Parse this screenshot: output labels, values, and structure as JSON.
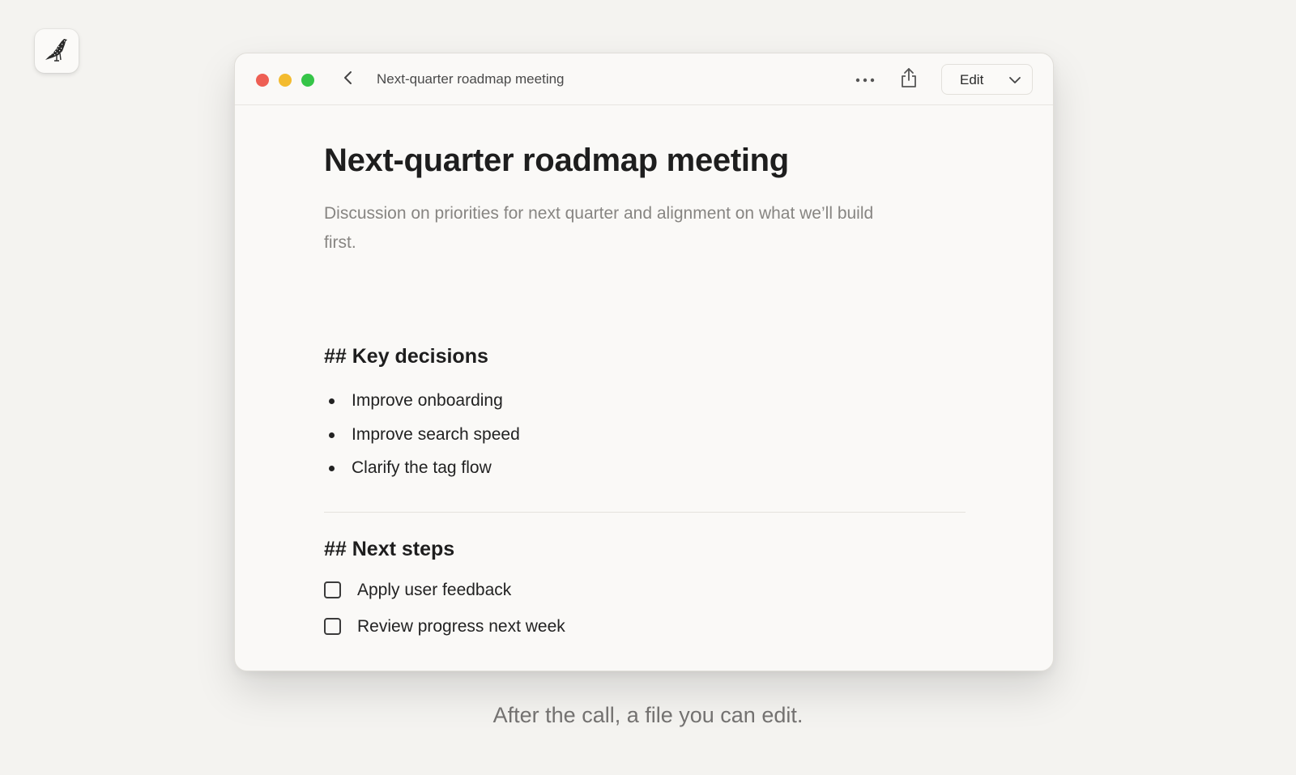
{
  "app": {
    "logo_icon": "bird-icon"
  },
  "window": {
    "title": "Next-quarter roadmap meeting",
    "controls": {
      "close_color": "#ee5f54",
      "minimize_color": "#f3bb2f",
      "maximize_color": "#35c548"
    },
    "toolbar": {
      "back_icon": "chevron-left-icon",
      "more_icon": "ellipsis-icon",
      "share_icon": "share-icon",
      "edit_label": "Edit",
      "edit_dropdown_icon": "chevron-down-icon"
    }
  },
  "document": {
    "title": "Next-quarter roadmap meeting",
    "subtitle": "Discussion on priorities for next quarter and alignment on what we’ll build first.",
    "sections": [
      {
        "heading": "## Key decisions",
        "items": [
          "Improve onboarding",
          "Improve search speed",
          "Clarify the tag flow"
        ]
      },
      {
        "heading": "## Next steps",
        "tasks": [
          {
            "label": "Apply user feedback",
            "checked": false
          },
          {
            "label": "Review progress next week",
            "checked": false
          }
        ]
      }
    ]
  },
  "caption": "After the call, a file you can edit."
}
